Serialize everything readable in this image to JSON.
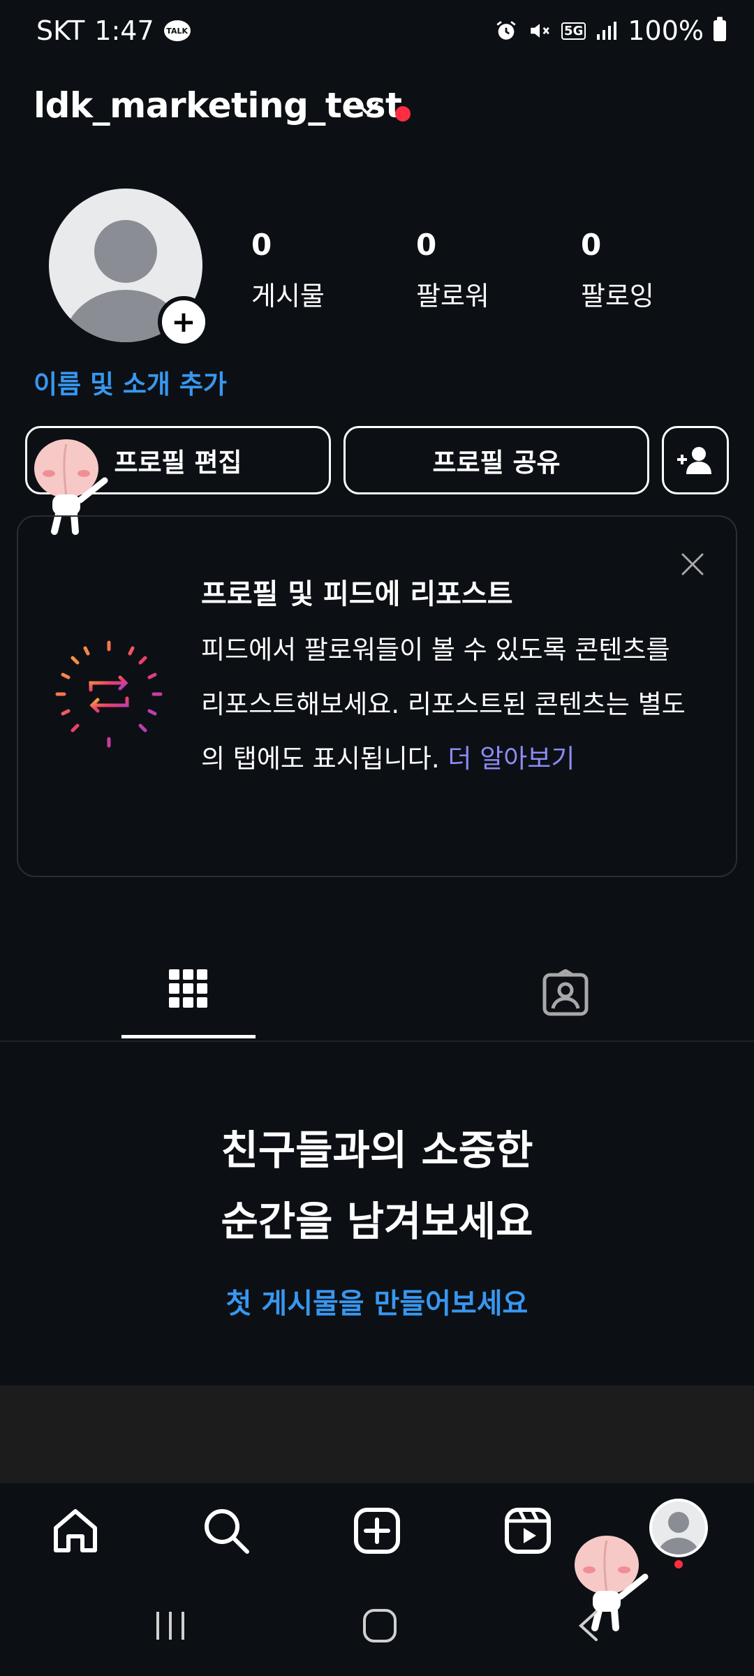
{
  "status_bar": {
    "carrier": "SKT",
    "time": "1:47",
    "talk_badge": "TALK",
    "network": "5G",
    "battery": "100%"
  },
  "header": {
    "username": "ldk_marketing_test"
  },
  "profile": {
    "stats": [
      {
        "value": "0",
        "label": "게시물"
      },
      {
        "value": "0",
        "label": "팔로워"
      },
      {
        "value": "0",
        "label": "팔로잉"
      }
    ],
    "add_bio_link": "이름 및 소개 추가"
  },
  "buttons": {
    "edit_profile": "프로필 편집",
    "share_profile": "프로필 공유"
  },
  "repost_card": {
    "title": "프로필 및 피드에 리포스트",
    "body": "피드에서 팔로워들이 볼 수 있도록 콘텐츠를 리포스트해보세요. 리포스트된 콘텐츠는 별도의 탭에도 표시됩니다.",
    "learn_more": "더 알아보기"
  },
  "tabs": [
    {
      "icon": "grid-icon",
      "active": true
    },
    {
      "icon": "tagged-icon",
      "active": false
    }
  ],
  "empty_state": {
    "title_line1": "친구들과의 소중한",
    "title_line2": "순간을 남겨보세요",
    "cta": "첫 게시물을 만들어보세요"
  },
  "bottom_nav": [
    "home-icon",
    "search-icon",
    "create-icon",
    "reels-icon",
    "profile-avatar"
  ],
  "colors": {
    "background": "#0c1014",
    "link_blue": "#3897f0",
    "learn_more": "#8c8cf6",
    "notification_red": "#ff2d41"
  }
}
